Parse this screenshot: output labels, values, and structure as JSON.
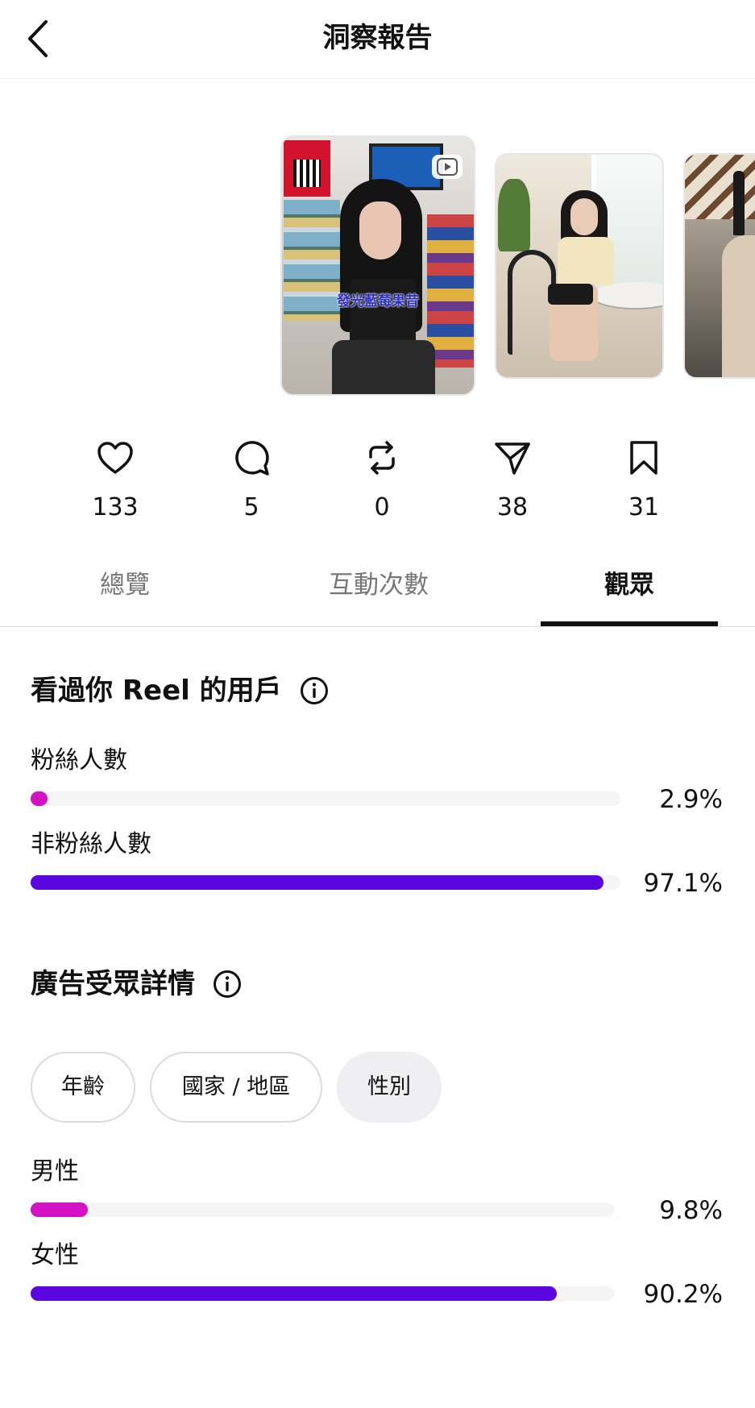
{
  "header": {
    "title": "洞察報告",
    "back_icon": "chevron-left-icon"
  },
  "thumbnails": [
    {
      "caption": "發光藍莓果昔",
      "icon": "reel-play-icon"
    },
    {
      "caption": ""
    },
    {
      "caption": ""
    }
  ],
  "stats": [
    {
      "icon": "heart-icon",
      "value": "133"
    },
    {
      "icon": "comment-icon",
      "value": "5"
    },
    {
      "icon": "repost-icon",
      "value": "0"
    },
    {
      "icon": "share-icon",
      "value": "38"
    },
    {
      "icon": "bookmark-icon",
      "value": "31"
    }
  ],
  "tabs": [
    {
      "label": "總覽",
      "active": false
    },
    {
      "label": "互動次數",
      "active": false
    },
    {
      "label": "觀眾",
      "active": true
    }
  ],
  "viewers": {
    "title": "看過你 Reel 的用戶",
    "rows": [
      {
        "label": "粉絲人數",
        "percent_text": "2.9%",
        "fraction": 0.029,
        "color": "#d312c6"
      },
      {
        "label": "非粉絲人數",
        "percent_text": "97.1%",
        "fraction": 0.971,
        "color": "#5b06e0"
      }
    ]
  },
  "audience": {
    "title": "廣告受眾詳情",
    "chips": [
      {
        "label": "年齡",
        "selected": false
      },
      {
        "label": "國家 / 地區",
        "selected": false
      },
      {
        "label": "性別",
        "selected": true
      }
    ],
    "rows": [
      {
        "label": "男性",
        "percent_text": "9.8%",
        "fraction": 0.098,
        "color": "#d312c6"
      },
      {
        "label": "女性",
        "percent_text": "90.2%",
        "fraction": 0.902,
        "color": "#5b06e0"
      }
    ]
  }
}
